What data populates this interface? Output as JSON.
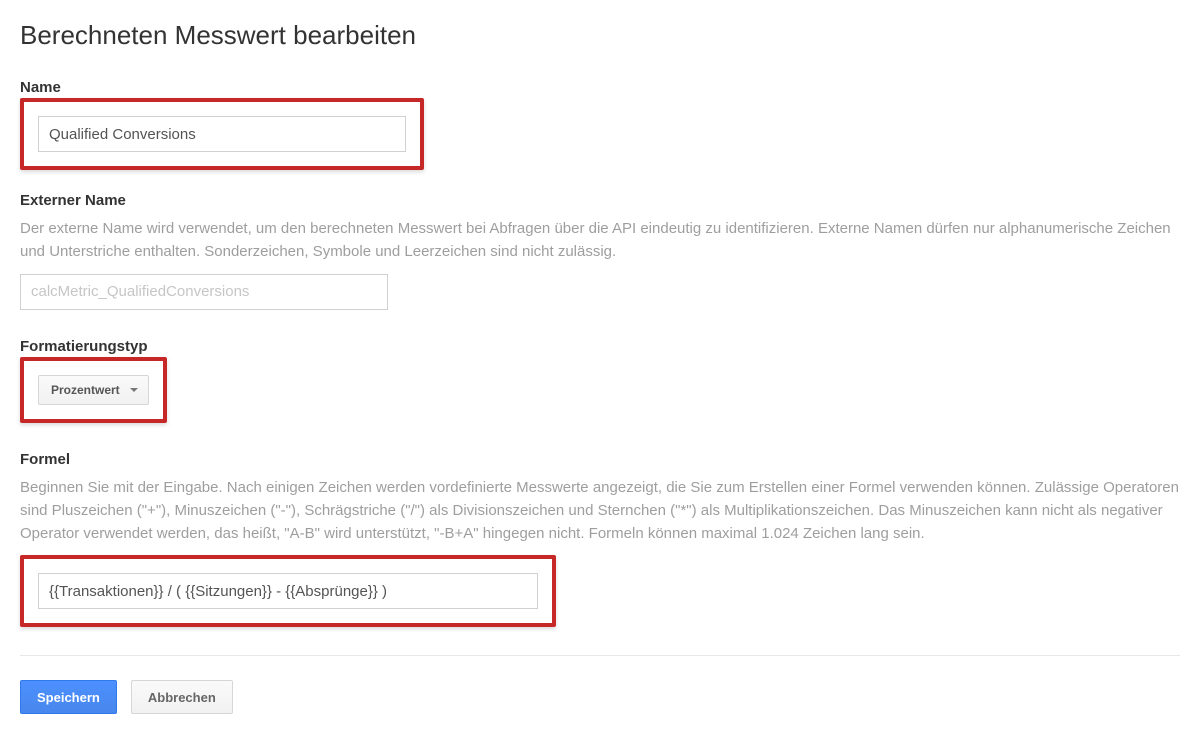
{
  "page_title": "Berechneten Messwert bearbeiten",
  "name_section": {
    "label": "Name",
    "value": "Qualified Conversions"
  },
  "external_name_section": {
    "label": "Externer Name",
    "description": "Der externe Name wird verwendet, um den berechneten Messwert bei Abfragen über die API eindeutig zu identifizieren. Externe Namen dürfen nur alphanumerische Zeichen und Unterstriche enthalten. Sonderzeichen, Symbole und Leerzeichen sind nicht zulässig.",
    "placeholder": "calcMetric_QualifiedConversions"
  },
  "format_section": {
    "label": "Formatierungstyp",
    "selected": "Prozentwert"
  },
  "formula_section": {
    "label": "Formel",
    "description": "Beginnen Sie mit der Eingabe. Nach einigen Zeichen werden vordefinierte Messwerte angezeigt, die Sie zum Erstellen einer Formel verwenden können. Zulässige Operatoren sind Pluszeichen (\"+\"), Minuszeichen (\"-\"), Schrägstriche (\"/\") als Divisionszeichen und Sternchen (\"*\") als Multiplikationszeichen. Das Minuszeichen kann nicht als negativer Operator verwendet werden, das heißt, \"A-B\" wird unterstützt, \"-B+A\" hingegen nicht. Formeln können maximal 1.024 Zeichen lang sein.",
    "value": "{{Transaktionen}} / ( {{Sitzungen}} - {{Absprünge}} )"
  },
  "buttons": {
    "save": "Speichern",
    "cancel": "Abbrechen"
  }
}
